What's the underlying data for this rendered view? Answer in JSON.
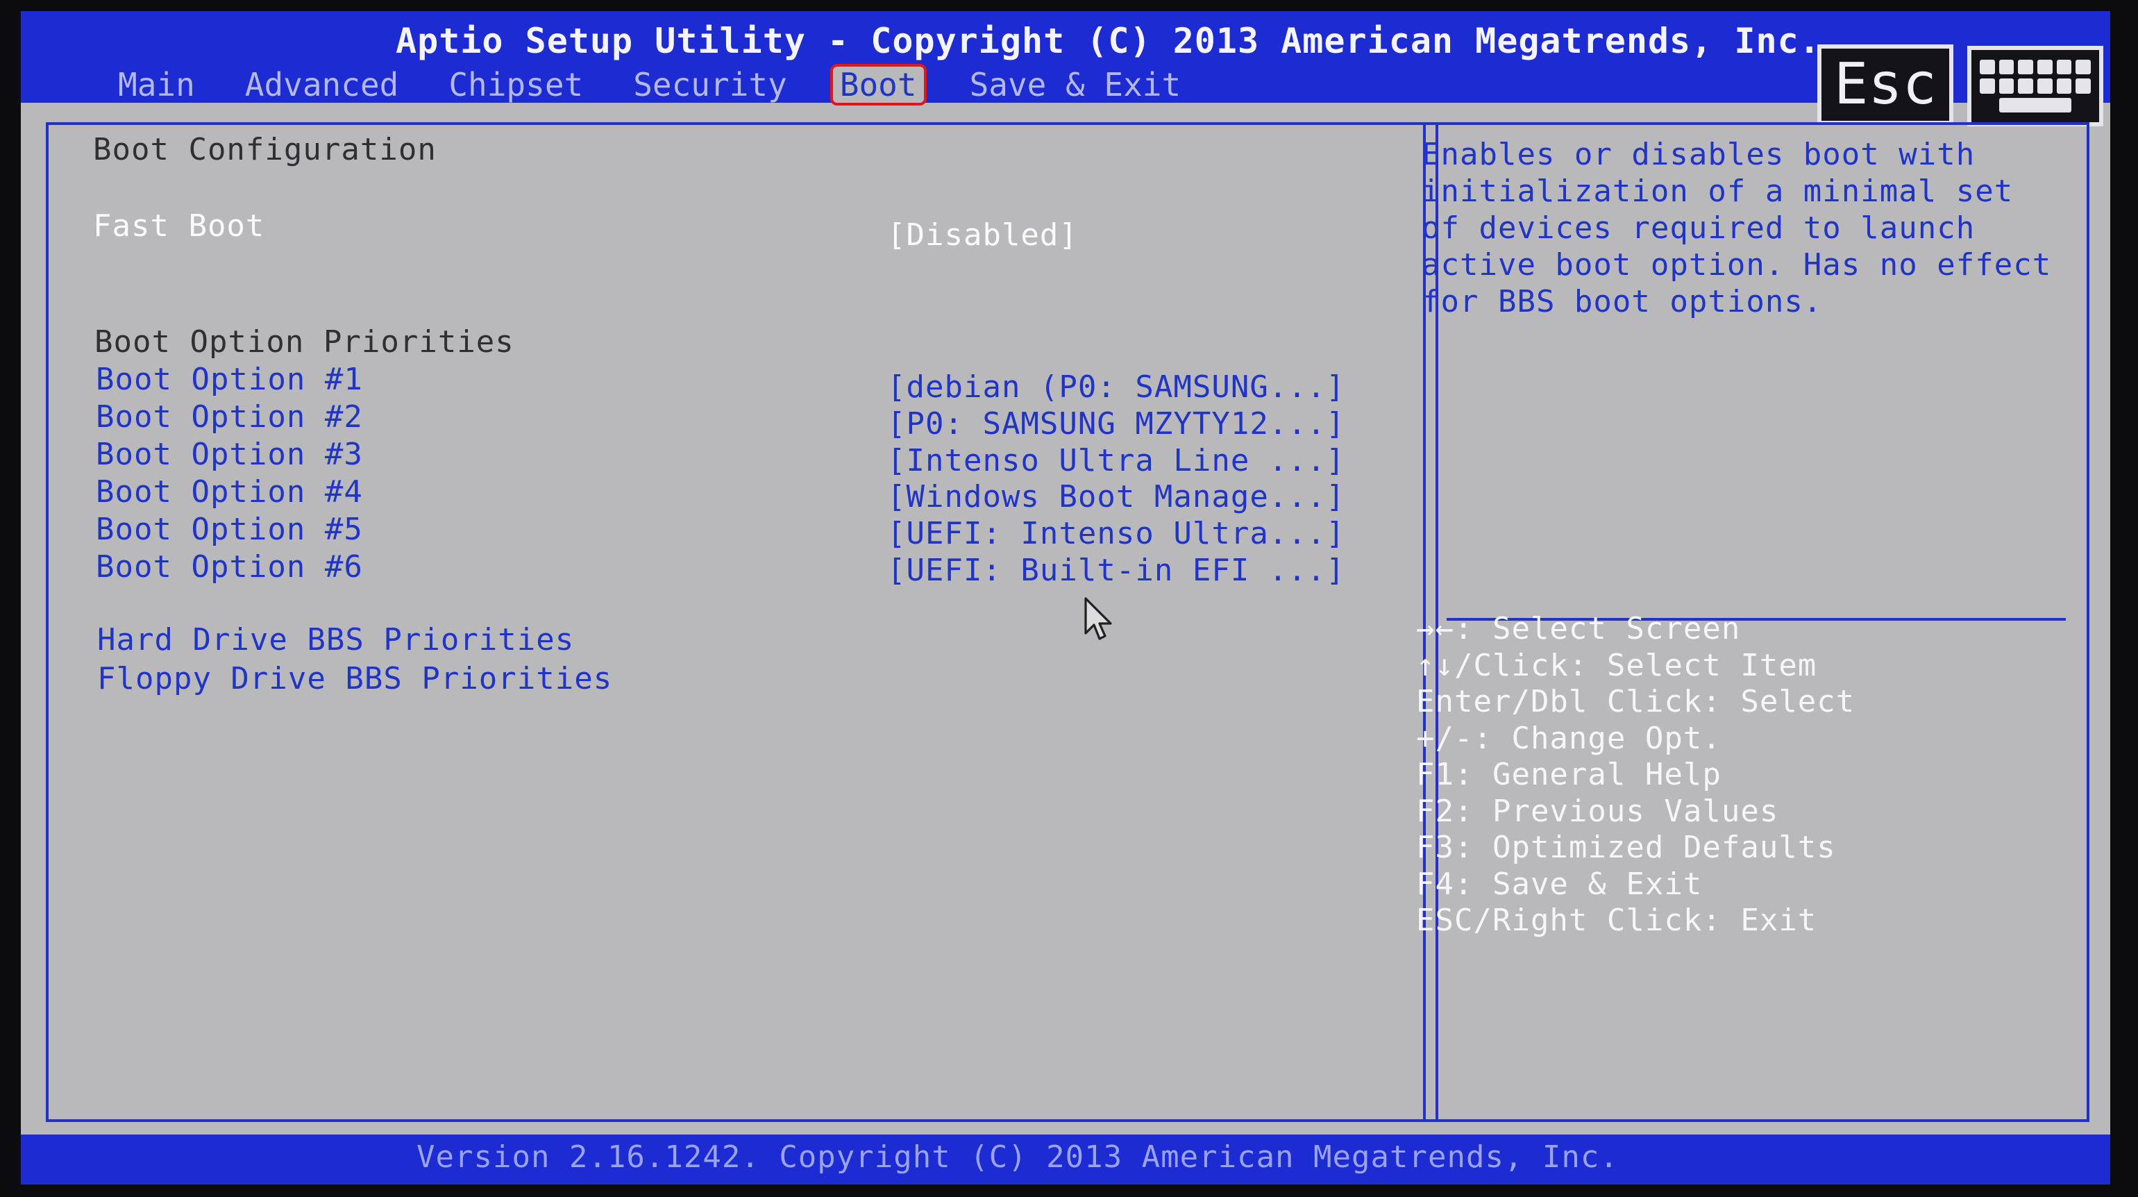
{
  "header": {
    "title": "Aptio Setup Utility - Copyright (C) 2013 American Megatrends, Inc.",
    "tabs": [
      {
        "label": "Main"
      },
      {
        "label": "Advanced"
      },
      {
        "label": "Chipset"
      },
      {
        "label": "Security"
      },
      {
        "label": "Boot",
        "active": true
      },
      {
        "label": "Save & Exit"
      }
    ],
    "esc_label": "Esc"
  },
  "main": {
    "section_title": "Boot Configuration",
    "fast_boot": {
      "label": "Fast Boot",
      "value": "[Disabled]"
    },
    "priorities_title": "Boot Option Priorities",
    "boot_options": [
      {
        "label": "Boot Option #1",
        "value": "[debian (P0: SAMSUNG...]"
      },
      {
        "label": "Boot Option #2",
        "value": "[P0: SAMSUNG MZYTY12...]"
      },
      {
        "label": "Boot Option #3",
        "value": "[Intenso Ultra Line ...]"
      },
      {
        "label": "Boot Option #4",
        "value": "[Windows Boot Manage...]"
      },
      {
        "label": "Boot Option #5",
        "value": "[UEFI: Intenso Ultra...]"
      },
      {
        "label": "Boot Option #6",
        "value": "[UEFI: Built-in EFI ...]"
      }
    ],
    "submenus": [
      "Hard Drive BBS Priorities",
      "Floppy Drive BBS Priorities"
    ]
  },
  "help": {
    "description": "Enables or disables boot with initialization of a minimal set of devices required to launch active boot option. Has no effect for BBS boot options.",
    "keys": [
      "→←: Select Screen",
      "↑↓/Click: Select Item",
      "Enter/Dbl Click: Select",
      "+/-: Change Opt.",
      "F1: General Help",
      "F2: Previous Values",
      "F3: Optimized Defaults",
      "F4: Save & Exit",
      "ESC/Right Click: Exit"
    ]
  },
  "footer": {
    "version": "Version 2.16.1242. Copyright (C) 2013 American Megatrends, Inc."
  },
  "colors": {
    "header_blue": "#1c2bd2",
    "panel_gray": "#b9b9bb",
    "item_blue": "#2034c8",
    "highlight_red": "#e0161c"
  },
  "icons": [
    "mouse-pointer-icon",
    "keyboard-icon"
  ]
}
